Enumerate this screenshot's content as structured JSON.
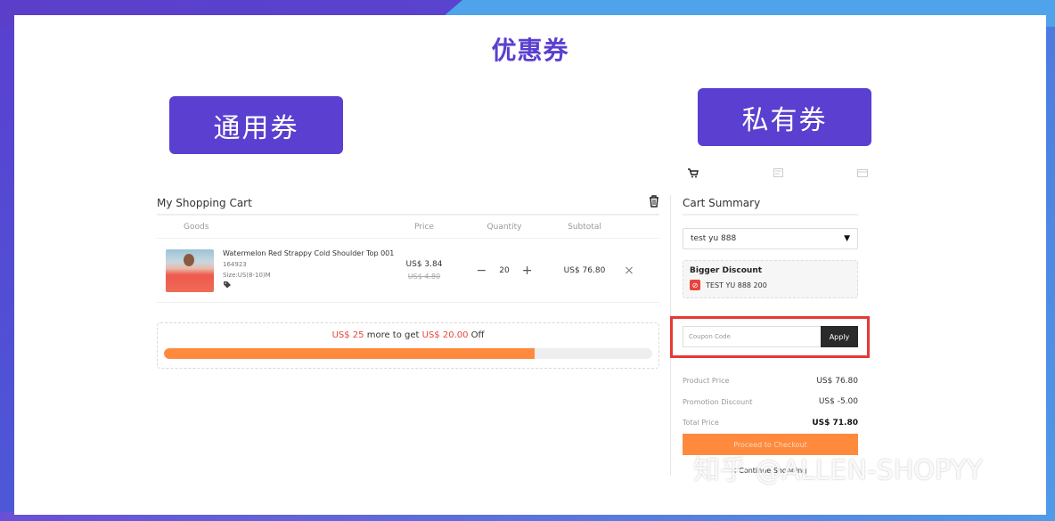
{
  "slide": {
    "title": "优惠券",
    "tag_general": "通用券",
    "tag_private": "私有券"
  },
  "steps": [
    {
      "icon": "cart-icon",
      "glyph": "🛒"
    },
    {
      "icon": "checkout-icon",
      "glyph": "▣"
    },
    {
      "icon": "payment-icon",
      "glyph": "▤"
    }
  ],
  "cart": {
    "title": "My Shopping Cart",
    "columns": {
      "goods": "Goods",
      "price": "Price",
      "quantity": "Quantity",
      "subtotal": "Subtotal"
    },
    "item": {
      "name": "Watermelon Red Strappy Cold Shoulder Top 001",
      "sku": "164923",
      "size": "Size:US(8-10)M",
      "price": "US$ 3.84",
      "original_price": "US$ 4.80",
      "quantity": "20",
      "subtotal": "US$ 76.80"
    },
    "promo": {
      "amount_needed": "US$ 25",
      "middle_text": "more to get",
      "discount": "US$ 20.00",
      "suffix": "Off",
      "progress": 0.76
    }
  },
  "summary": {
    "title": "Cart Summary",
    "selected_coupon": "test yu 888",
    "discount_title": "Bigger Discount",
    "discount_coupon": "TEST YU 888 200",
    "coupon_placeholder": "Coupon Code",
    "apply_label": "Apply",
    "product_price_label": "Product Price",
    "product_price": "US$ 76.80",
    "promotion_label": "Promotion Discount",
    "promotion_value": "US$ -5.00",
    "total_label": "Total Price",
    "total_value": "US$ 71.80",
    "checkout_label": "Proceed to Checkout",
    "continue_label": "< Continue Shopping"
  },
  "watermark": "知乎 @ALLEN-SHOPYY",
  "colors": {
    "accent": "#5a3fd0",
    "orange": "#ff8a3d",
    "red": "#e8453c",
    "highlight": "#e53935"
  }
}
